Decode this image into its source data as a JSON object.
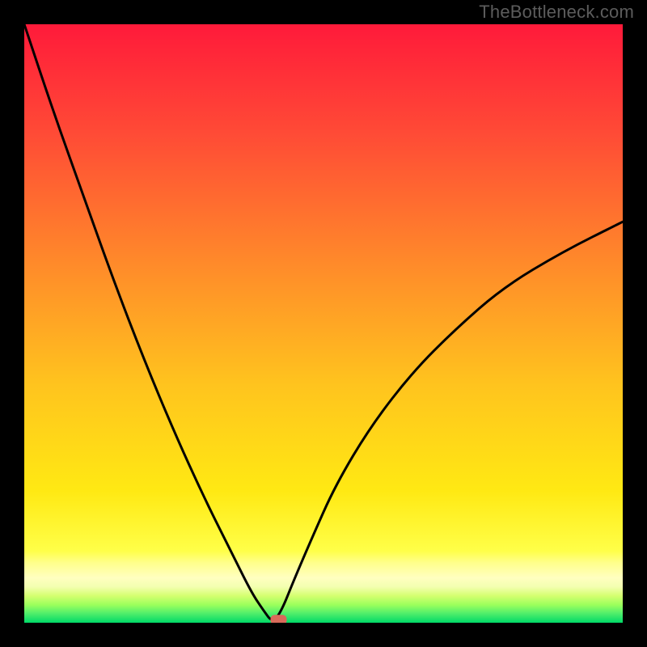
{
  "watermark": "TheBottleneck.com",
  "chart_data": {
    "type": "line",
    "title": "",
    "xlabel": "",
    "ylabel": "",
    "xlim": [
      0,
      100
    ],
    "ylim": [
      0,
      100
    ],
    "background_gradient": {
      "top_color": "#ff1a3a",
      "mid_color": "#ffd400",
      "bottom_band_colors": [
        "#ffff8c",
        "#d4ff70",
        "#7cff5c",
        "#00e676"
      ]
    },
    "series": [
      {
        "name": "curve",
        "x": [
          0,
          5,
          10,
          15,
          20,
          25,
          30,
          35,
          38,
          40,
          41.5,
          43,
          45,
          48,
          52,
          58,
          65,
          72,
          80,
          90,
          100
        ],
        "y": [
          100,
          85,
          71,
          57,
          44,
          32,
          21,
          11,
          5,
          2,
          0,
          2,
          7,
          14,
          23,
          33,
          42,
          49,
          56,
          62,
          67
        ]
      }
    ],
    "marker": {
      "x": 42.5,
      "y": 0.5,
      "color": "#d96a5a",
      "shape": "rounded-rect"
    }
  },
  "colors": {
    "curve_stroke": "#000000",
    "frame": "#000000"
  }
}
